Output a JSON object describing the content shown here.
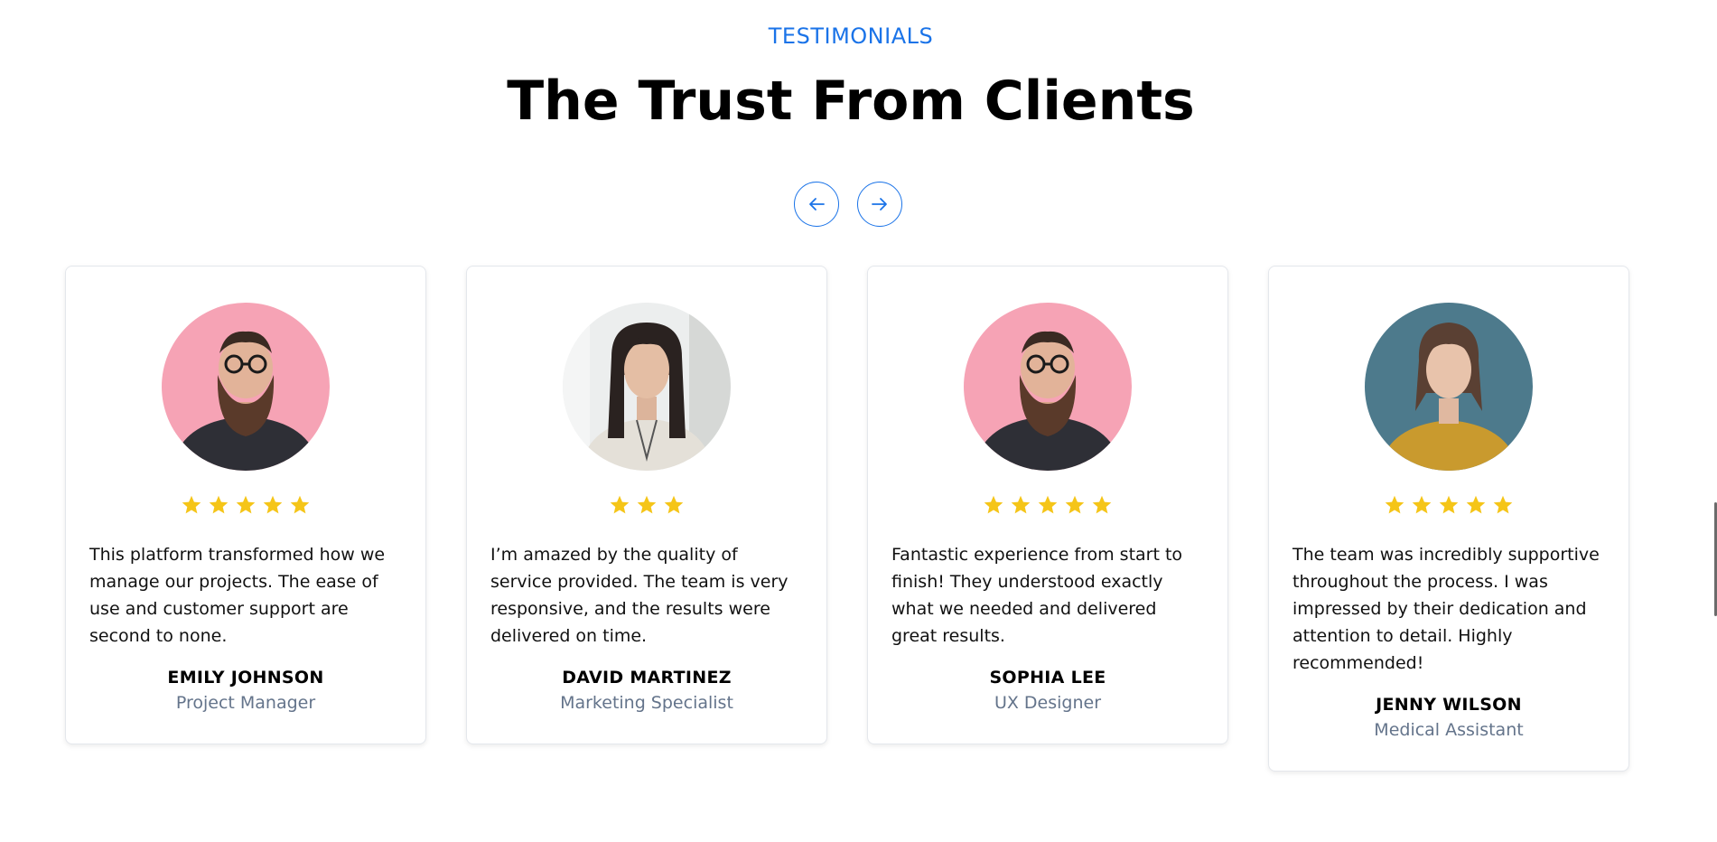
{
  "section": {
    "eyebrow": "TESTIMONIALS",
    "title": "The Trust From Clients"
  },
  "nav": {
    "prev_icon": "arrow-left-icon",
    "next_icon": "arrow-right-icon"
  },
  "colors": {
    "accent": "#1a73e8",
    "star": "#f5c518",
    "role_text": "#64748b"
  },
  "testimonials": [
    {
      "avatar": "man-with-beard-pink-background",
      "rating": 5,
      "quote": "This platform transformed how we manage our projects. The ease of use and customer support are second to none.",
      "name": "EMILY JOHNSON",
      "role": "Project Manager"
    },
    {
      "avatar": "woman-long-dark-hair-office",
      "rating": 3,
      "quote": "I’m amazed by the quality of service provided. The team is very responsive, and the results were delivered on time.",
      "name": "DAVID MARTINEZ",
      "role": "Marketing Specialist"
    },
    {
      "avatar": "man-with-beard-pink-background",
      "rating": 5,
      "quote": "Fantastic experience from start to finish! They understood exactly what we needed and delivered great results.",
      "name": "SOPHIA LEE",
      "role": "UX Designer"
    },
    {
      "avatar": "woman-yellow-shirt-teal-background",
      "rating": 5,
      "quote": "The team was incredibly supportive throughout the process. I was impressed by their dedication and attention to detail. Highly recommended!",
      "name": "JENNY WILSON",
      "role": "Medical Assistant"
    }
  ]
}
